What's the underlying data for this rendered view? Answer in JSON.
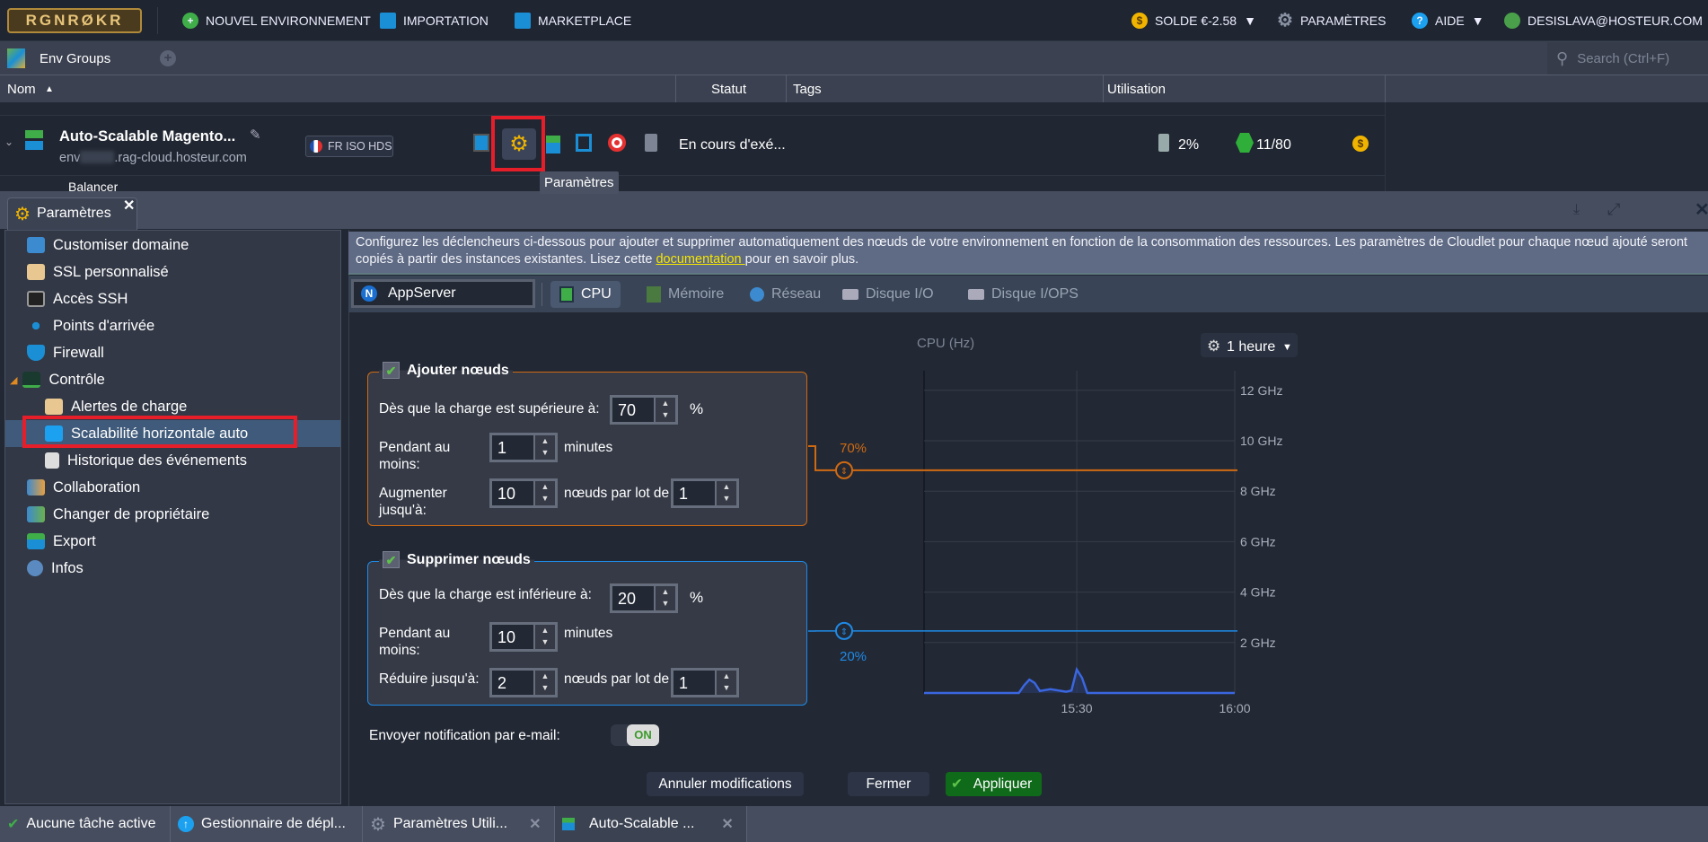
{
  "topbar": {
    "logo": "RGNRØKR",
    "new_env": "NOUVEL ENVIRONNEMENT",
    "import": "IMPORTATION",
    "marketplace": "MARKETPLACE",
    "balance": "SOLDE €-2.58",
    "settings": "PARAMÈTRES",
    "help": "AIDE",
    "user": "DESISLAVA@HOSTEUR.COM"
  },
  "envbar": {
    "group": "Env Groups",
    "search_placeholder": "Search (Ctrl+F)"
  },
  "columns": {
    "name": "Nom",
    "status": "Statut",
    "tags": "Tags",
    "usage": "Utilisation"
  },
  "env": {
    "name": "Auto-Scalable Magento...",
    "domain_prefix": "env",
    "domain_suffix": ".rag-cloud.hosteur.com",
    "region": "FR ISO HDS",
    "status": "En cours d'exé...",
    "disk": "2%",
    "cloudlets": "11/80",
    "sub_node": "Balancer",
    "tooltip": "Paramètres"
  },
  "panel": {
    "tab": "Paramètres"
  },
  "sidebar": {
    "items": [
      {
        "label": "Customiser domaine"
      },
      {
        "label": "SSL personnalisé"
      },
      {
        "label": "Accès SSH"
      },
      {
        "label": "Points d'arrivée"
      },
      {
        "label": "Firewall"
      },
      {
        "label": "Contrôle"
      },
      {
        "label": "Alertes de charge"
      },
      {
        "label": "Scalabilité horizontale auto",
        "selected": true
      },
      {
        "label": "Historique des événements"
      },
      {
        "label": "Collaboration"
      },
      {
        "label": "Changer de propriétaire"
      },
      {
        "label": "Export"
      },
      {
        "label": "Infos"
      }
    ]
  },
  "info": {
    "text1": "Configurez les déclencheurs ci-dessous pour ajouter et supprimer automatiquement des nœuds de votre environnement en fonction de la consommation des ressources. Les paramètres de Cloudlet pour chaque nœud ajouté seront copiés à partir des instances existantes. Lisez cette ",
    "link": "documentation ",
    "text2": "pour en savoir plus."
  },
  "node": "AppServer",
  "tabs": [
    {
      "label": "CPU",
      "active": true
    },
    {
      "label": "Mémoire"
    },
    {
      "label": "Réseau"
    },
    {
      "label": "Disque I/O"
    },
    {
      "label": "Disque I/OPS"
    }
  ],
  "add": {
    "title": "Ajouter nœuds",
    "checked": true,
    "load_label": "Dès que la charge est supérieure à:",
    "load": "70",
    "unit": "%",
    "during_label": "Pendant au moins:",
    "during": "1",
    "minutes": "minutes",
    "limit_label": "Augmenter jusqu'à:",
    "limit": "10",
    "batch_label": "nœuds par lot de",
    "batch": "1"
  },
  "remove": {
    "title": "Supprimer nœuds",
    "checked": true,
    "load_label": "Dès que la charge est inférieure à:",
    "load": "20",
    "unit": "%",
    "during_label": "Pendant au moins:",
    "during": "10",
    "minutes": "minutes",
    "limit_label": "Réduire jusqu'à:",
    "limit": "2",
    "batch_label": "nœuds par lot de",
    "batch": "1"
  },
  "notify": {
    "label": "Envoyer notification par e-mail:",
    "state": "ON"
  },
  "buttons": {
    "cancel": "Annuler modifications",
    "close": "Fermer",
    "apply": "Appliquer"
  },
  "taskbar": [
    {
      "label": "Aucune tâche active"
    },
    {
      "label": "Gestionnaire de dépl..."
    },
    {
      "label": "Paramètres Utili..."
    },
    {
      "label": "Auto-Scalable ..."
    }
  ],
  "colors": {
    "add": "#d06a12",
    "remove": "#1f8ae6",
    "series": "#3a66e0",
    "apply": "#0f6b1a"
  },
  "chart_data": {
    "type": "line",
    "title": "CPU (Hz)",
    "period": "1 heure",
    "ylim": [
      0,
      12.6
    ],
    "yticks": [
      2,
      4,
      6,
      8,
      10,
      12
    ],
    "ytick_labels": [
      "2 GHz",
      "4 GHz",
      "6 GHz",
      "8 GHz",
      "10 GHz",
      "12 GHz"
    ],
    "xticks": [
      "15:30",
      "16:00"
    ],
    "grid": true,
    "thresholds": [
      {
        "label": "70%",
        "value_ghz": 8.83,
        "color": "#d06a12"
      },
      {
        "label": "20%",
        "value_ghz": 2.46,
        "color": "#1f8ae6"
      }
    ],
    "series": [
      {
        "x": [
          "15:01",
          "15:19",
          "15:20",
          "15:21",
          "15:22",
          "15:23",
          "15:25",
          "15:28",
          "15:29",
          "15:30",
          "15:31",
          "15:32",
          "16:00"
        ],
        "y": [
          0,
          0,
          0.3,
          0.53,
          0.4,
          0.08,
          0.15,
          0.05,
          0.1,
          0.93,
          0.6,
          0,
          0
        ]
      }
    ]
  }
}
